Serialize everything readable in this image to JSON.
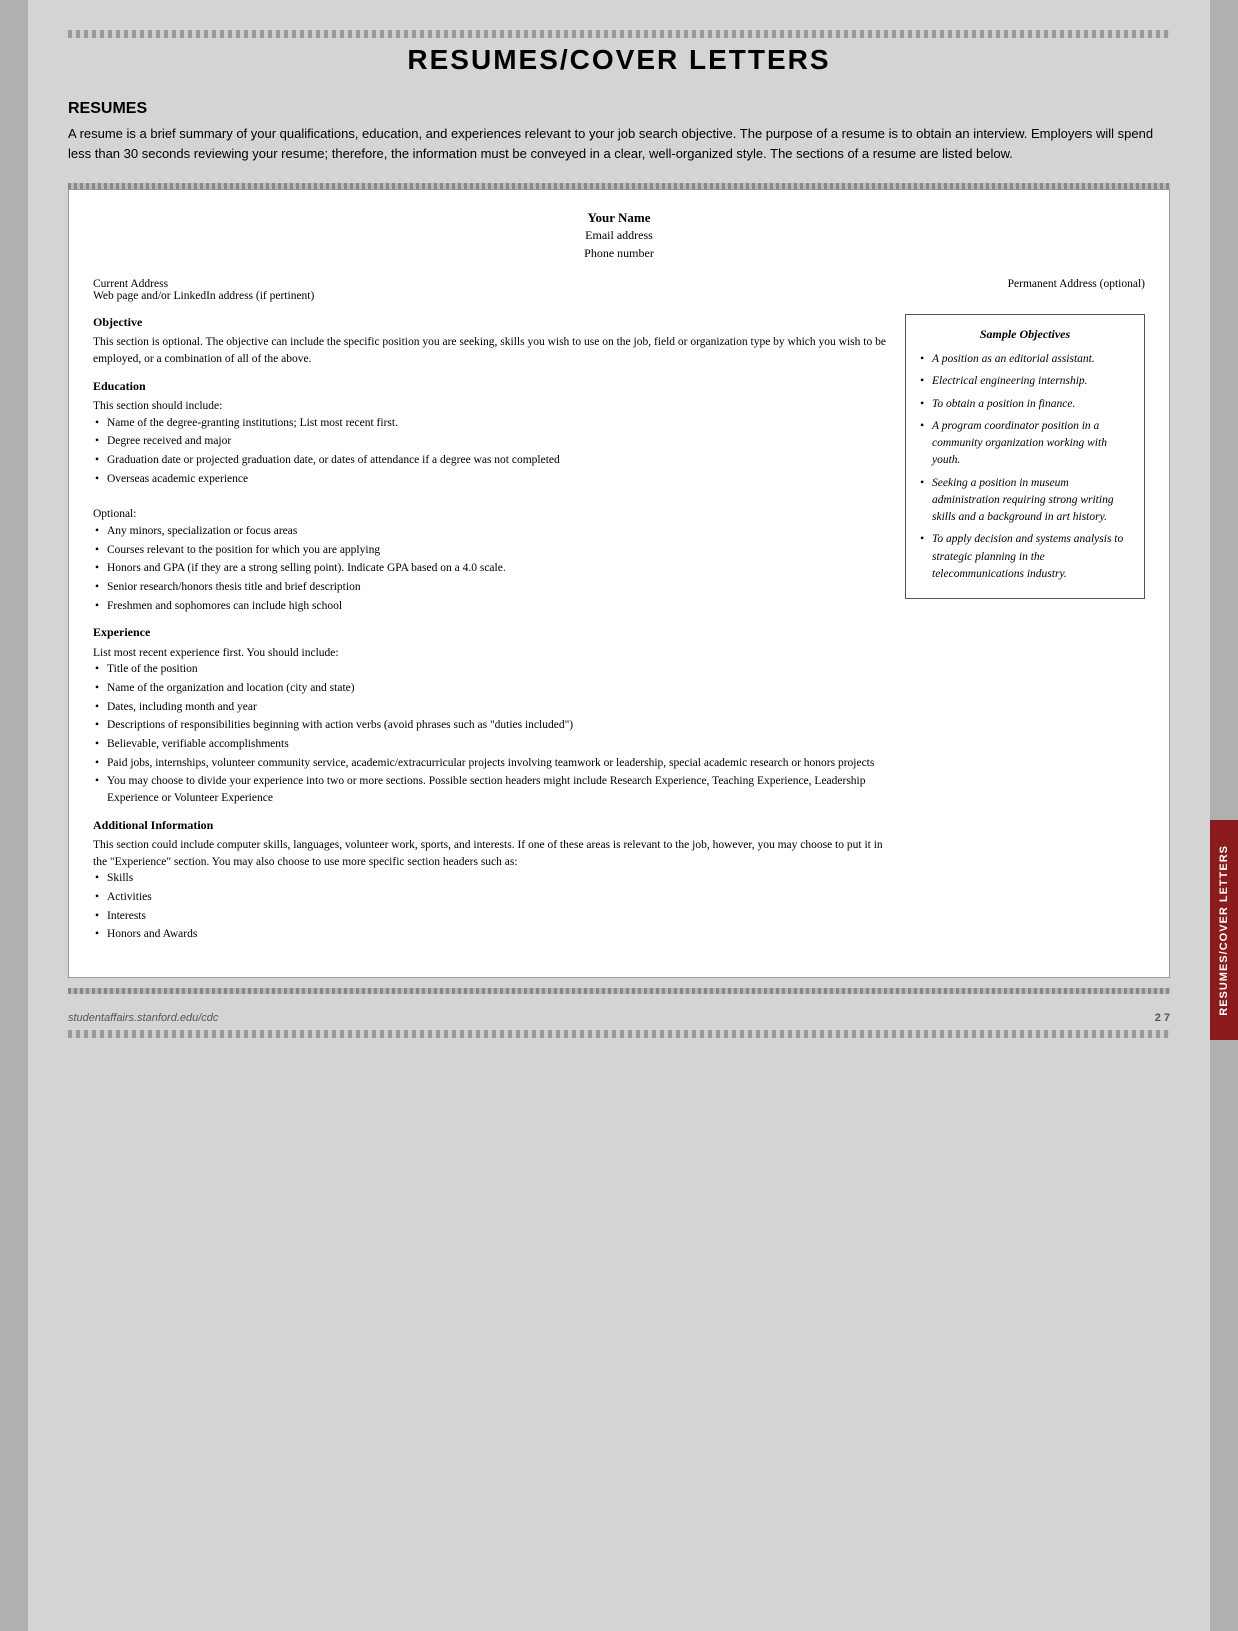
{
  "page": {
    "title": "RESUMES/COVER LETTERS",
    "section1": {
      "heading": "RESUMES",
      "intro": "A resume is a brief summary of your qualifications, education, and experiences relevant to your job search objective. The purpose of a resume is to obtain an interview. Employers will spend less than 30 seconds reviewing your resume; therefore, the information must be conveyed in a clear, well-organized style. The sections of a resume are listed below."
    }
  },
  "resume_template": {
    "name": "Your Name",
    "email": "Email address",
    "phone": "Phone number",
    "current_address_label": "Current Address",
    "current_address_sub": "Web page and/or LinkedIn address (if pertinent)",
    "permanent_address_label": "Permanent Address (optional)",
    "objective_title": "Objective",
    "objective_text": "This section is optional. The objective can include the specific position you are seeking, skills you wish to use on the job, field or organization type by which you wish to be employed, or a combination of all of the above.",
    "education_title": "Education",
    "education_text": "This section should include:",
    "education_bullets": [
      "Name of the degree-granting institutions; List most recent first.",
      "Degree received and major",
      "Graduation date or projected graduation date, or dates of attendance if a degree was not completed",
      "Overseas academic experience"
    ],
    "education_optional_label": "Optional:",
    "education_optional_bullets": [
      "Any minors, specialization or focus areas",
      "Courses relevant to the position for which you are applying",
      "Honors and GPA (if they are a strong selling point). Indicate GPA based on a 4.0 scale.",
      "Senior research/honors thesis title and brief description",
      "Freshmen and sophomores can include high school"
    ],
    "experience_title": "Experience",
    "experience_intro": "List most recent experience first. You should include:",
    "experience_bullets": [
      "Title of the position",
      "Name of the organization and location (city and state)",
      "Dates, including month and year",
      "Descriptions of responsibilities beginning with action verbs (avoid phrases such as \"duties included\")",
      "Believable, verifiable accomplishments",
      "Paid jobs, internships, volunteer community service, academic/extracurricular projects involving teamwork or leadership, special academic research or honors projects",
      "You may choose to divide your experience into two or more sections. Possible section headers might include Research Experience, Teaching Experience, Leadership Experience or Volunteer Experience"
    ],
    "additional_title": "Additional Information",
    "additional_text": "This section could include computer skills, languages, volunteer work, sports, and interests. If one of these areas is relevant to the job, however, you may choose to put it in the \"Experience\" section. You may also choose to use more specific section headers such as:",
    "additional_bullets": [
      "Skills",
      "Activities",
      "Interests",
      "Honors and Awards"
    ]
  },
  "sample_objectives": {
    "title": "Sample Objectives",
    "items": [
      "A position as an editorial assistant.",
      "Electrical engineering internship.",
      "To obtain a position in finance.",
      "A program coordinator position in a community organization working with youth.",
      "Seeking a position in museum administration requiring strong writing skills and a background in art history.",
      "To apply decision and systems analysis to strategic planning in the telecommunications industry."
    ]
  },
  "footer": {
    "url": "studentaffairs.stanford.edu/cdc",
    "page": "2  7"
  },
  "right_tab": {
    "label": "RESUMES/COVER LETTERS"
  }
}
